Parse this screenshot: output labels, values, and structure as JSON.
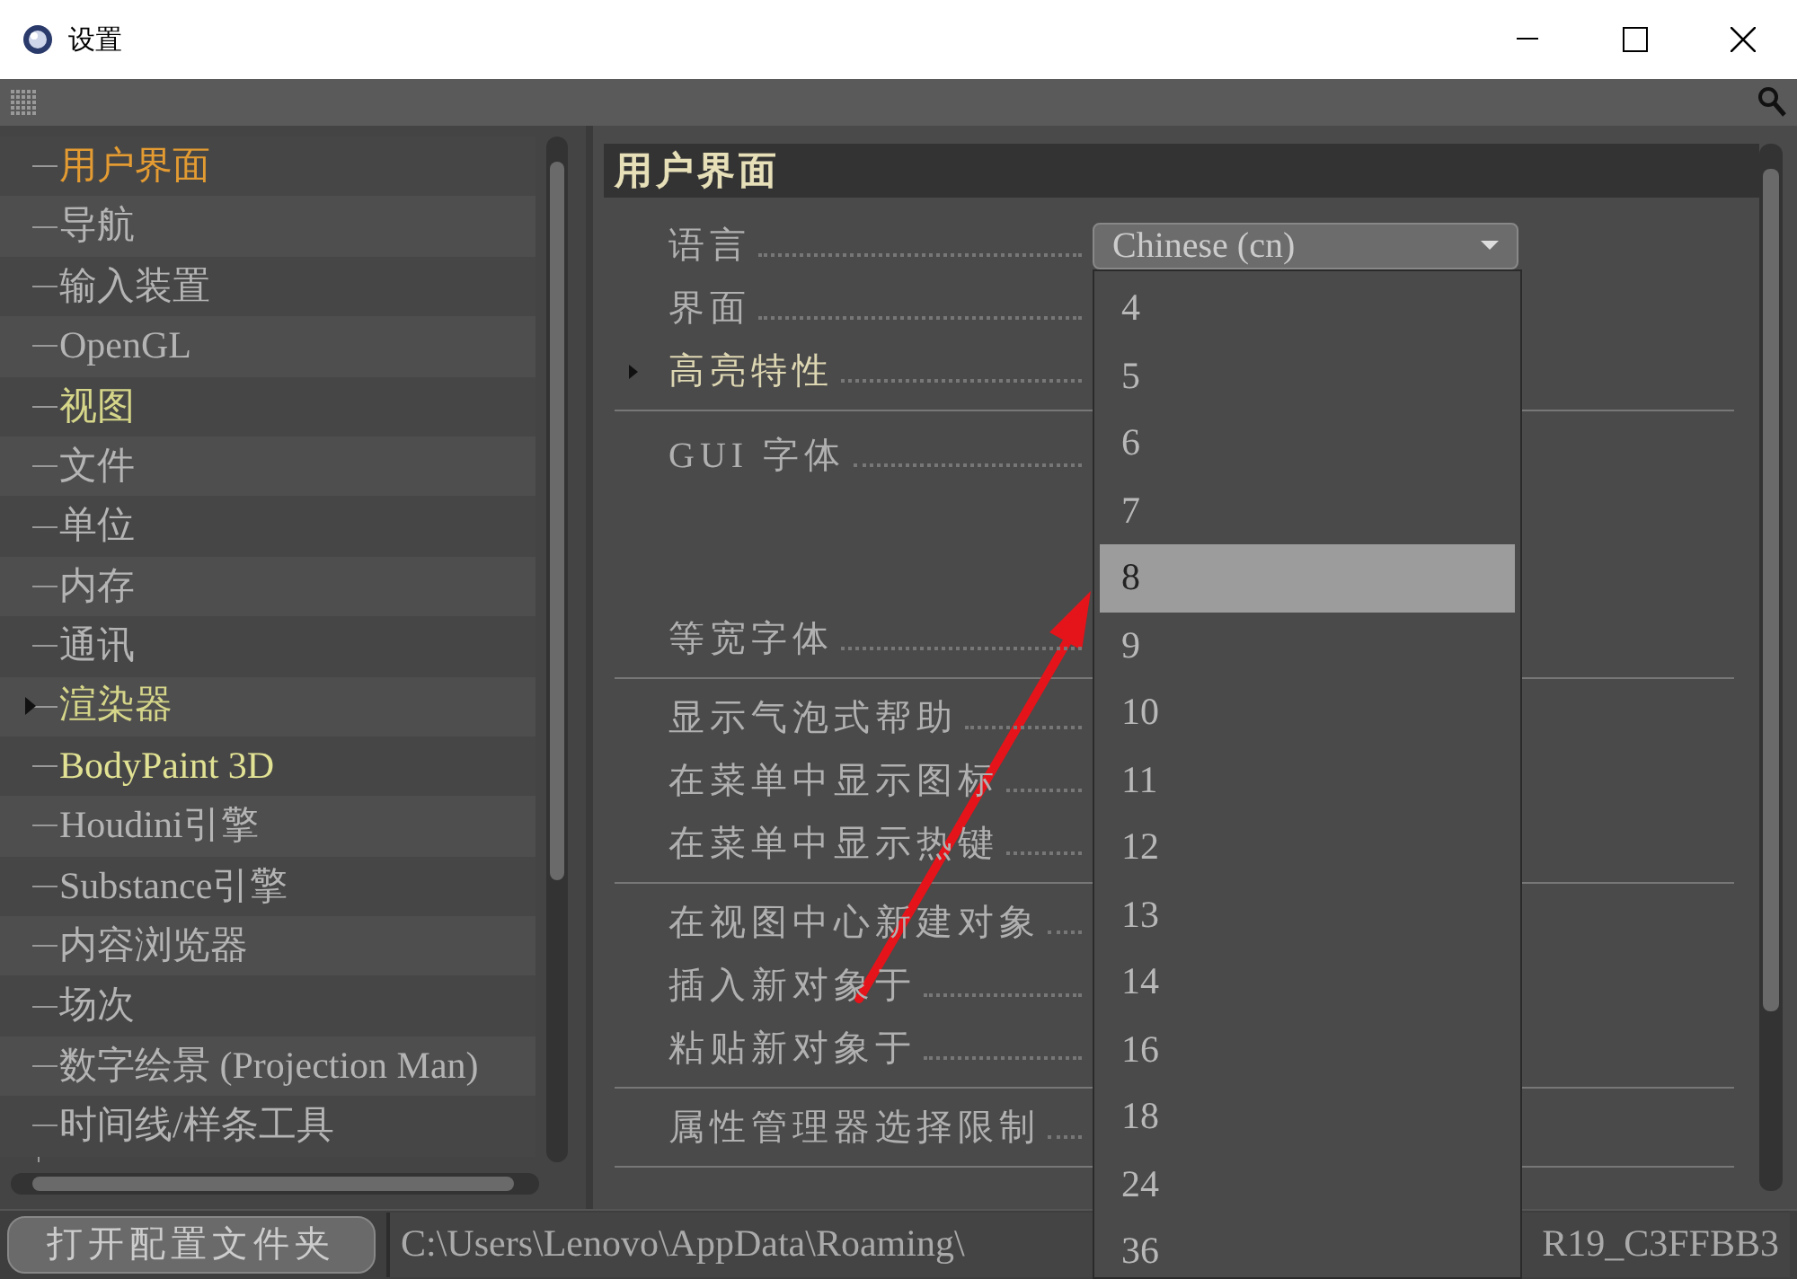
{
  "window": {
    "title": "设置"
  },
  "tree": {
    "items": [
      {
        "label": "用户界面",
        "color": "#e39b32",
        "expandable": false
      },
      {
        "label": "导航",
        "color": "#b4b4b4",
        "expandable": false
      },
      {
        "label": "输入装置",
        "color": "#b4b4b4",
        "expandable": false
      },
      {
        "label": "OpenGL",
        "color": "#b4b4b4",
        "expandable": false
      },
      {
        "label": "视图",
        "color": "#d6d68a",
        "expandable": false
      },
      {
        "label": "文件",
        "color": "#b4b4b4",
        "expandable": false
      },
      {
        "label": "单位",
        "color": "#b4b4b4",
        "expandable": false
      },
      {
        "label": "内存",
        "color": "#b4b4b4",
        "expandable": false
      },
      {
        "label": "通讯",
        "color": "#b4b4b4",
        "expandable": false
      },
      {
        "label": "渲染器",
        "color": "#d6d68a",
        "expandable": true
      },
      {
        "label": "BodyPaint 3D",
        "color": "#e2e294",
        "expandable": false
      },
      {
        "label": "Houdini引擎",
        "color": "#b4b4b4",
        "expandable": false
      },
      {
        "label": "Substance引擎",
        "color": "#b4b4b4",
        "expandable": false
      },
      {
        "label": "内容浏览器",
        "color": "#b4b4b4",
        "expandable": false
      },
      {
        "label": "场次",
        "color": "#b4b4b4",
        "expandable": false
      },
      {
        "label": "数字绘景 (Projection Man)",
        "color": "#b4b4b4",
        "expandable": false
      },
      {
        "label": "时间线/样条工具",
        "color": "#b4b4b4",
        "expandable": false
      }
    ]
  },
  "section": {
    "title": "用户界面"
  },
  "settings": [
    {
      "kind": "row",
      "label": "语言",
      "value": "Chinese (cn)"
    },
    {
      "kind": "row",
      "label": "界面"
    },
    {
      "kind": "group",
      "label": "高亮特性"
    },
    {
      "kind": "separator"
    },
    {
      "kind": "font",
      "label": "GUI 字体"
    },
    {
      "kind": "row",
      "label": "等宽字体"
    },
    {
      "kind": "separator"
    },
    {
      "kind": "row",
      "label": "显示气泡式帮助"
    },
    {
      "kind": "row",
      "label": "在菜单中显示图标"
    },
    {
      "kind": "row",
      "label": "在菜单中显示热键"
    },
    {
      "kind": "separator"
    },
    {
      "kind": "row",
      "label": "在视图中心新建对象"
    },
    {
      "kind": "row",
      "label": "插入新对象于"
    },
    {
      "kind": "row",
      "label": "粘贴新对象于"
    },
    {
      "kind": "separator"
    },
    {
      "kind": "row",
      "label": "属性管理器选择限制"
    },
    {
      "kind": "separator"
    }
  ],
  "dropdown": {
    "options": [
      {
        "label": "4",
        "selected": false
      },
      {
        "label": "5",
        "selected": false
      },
      {
        "label": "6",
        "selected": false
      },
      {
        "label": "7",
        "selected": false
      },
      {
        "label": "8",
        "selected": true
      },
      {
        "label": "9",
        "selected": false
      },
      {
        "label": "10",
        "selected": false
      },
      {
        "label": "11",
        "selected": false
      },
      {
        "label": "12",
        "selected": false
      },
      {
        "label": "13",
        "selected": false
      },
      {
        "label": "14",
        "selected": false
      },
      {
        "label": "16",
        "selected": false
      },
      {
        "label": "18",
        "selected": false
      },
      {
        "label": "24",
        "selected": false
      },
      {
        "label": "36",
        "selected": false
      }
    ]
  },
  "status_bar": {
    "button": "打开配置文件夹",
    "path": "C:\\Users\\Lenovo\\AppData\\Roaming\\",
    "path_tail": "R19_C3FFBB3"
  }
}
